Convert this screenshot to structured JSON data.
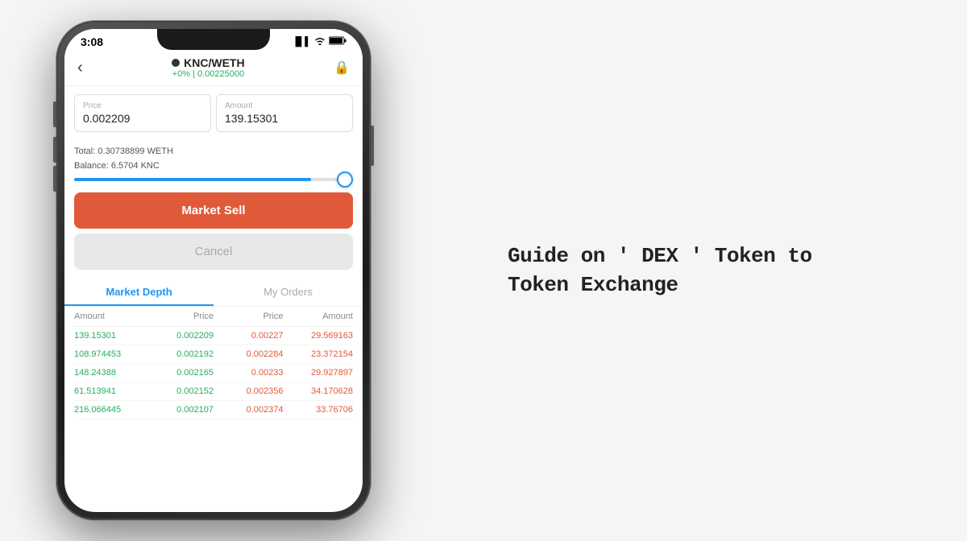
{
  "status": {
    "time": "3:08",
    "signal_icon": "📶",
    "wifi_icon": "WiFi",
    "battery_icon": "🔋"
  },
  "header": {
    "back_label": "‹",
    "pair": "KNC/WETH",
    "rate": "+0% | 0.00225000",
    "lock_icon": "🔒"
  },
  "price_input": {
    "label": "Price",
    "value": "0.002209"
  },
  "amount_input": {
    "label": "Amount",
    "value": "139.15301"
  },
  "total": {
    "text": "Total: 0.30738899 WETH",
    "balance": "Balance: 6.5704 KNC"
  },
  "buttons": {
    "market_sell": "Market Sell",
    "cancel": "Cancel"
  },
  "tabs": [
    {
      "label": "Market Depth",
      "active": true
    },
    {
      "label": "My Orders",
      "active": false
    }
  ],
  "table": {
    "headers": [
      "Amount",
      "Price",
      "Price",
      "Amount"
    ],
    "rows": [
      {
        "amt_left": "139.15301",
        "price_left": "0.002209",
        "price_right": "0.00227",
        "amt_right": "29.569163"
      },
      {
        "amt_left": "108.974453",
        "price_left": "0.002192",
        "price_right": "0.002284",
        "amt_right": "23.372154"
      },
      {
        "amt_left": "148.24388",
        "price_left": "0.002165",
        "price_right": "0.00233",
        "amt_right": "29.927897"
      },
      {
        "amt_left": "61.513941",
        "price_left": "0.002152",
        "price_right": "0.002356",
        "amt_right": "34.170628"
      },
      {
        "amt_left": "216.066445",
        "price_left": "0.002107",
        "price_right": "0.002374",
        "amt_right": "33.76706"
      }
    ]
  },
  "guide": {
    "title": "Guide on ' DEX ' Token to Token Exchange"
  }
}
